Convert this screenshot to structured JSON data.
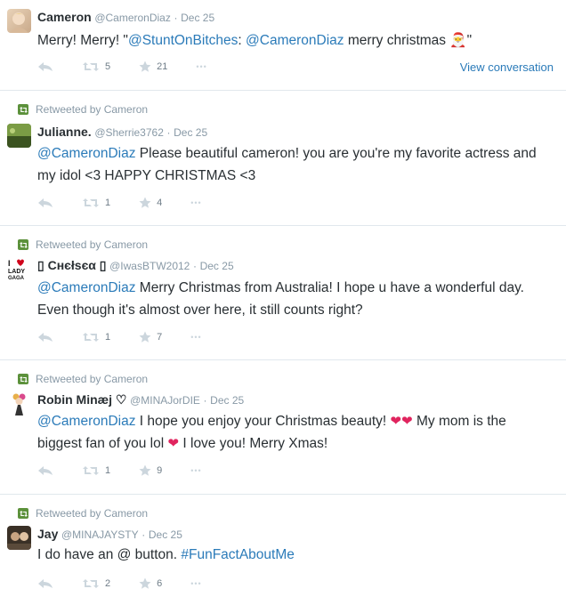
{
  "tweets": [
    {
      "retweeted_by": "",
      "name": "Cameron",
      "handle": "@CameronDiaz",
      "date": "Dec 25",
      "text_parts": {
        "a": "Merry! Merry! \"",
        "b": "@StuntOnBitches",
        "c": ": ",
        "d": "@CameronDiaz",
        "e": " merry christmas 🎅\""
      },
      "retweets": "5",
      "favorites": "21",
      "view_conversation": "View conversation"
    },
    {
      "retweeted_by": "Retweeted by Cameron",
      "name": "Julianne.",
      "handle": "@Sherrie3762",
      "date": "Dec 25",
      "text_parts": {
        "a": "@CameronDiaz",
        "b": " Please beautiful cameron! you are you're my favorite actress and my idol <3 HAPPY CHRISTMAS <3"
      },
      "retweets": "1",
      "favorites": "4"
    },
    {
      "retweeted_by": "Retweeted by Cameron",
      "name": "▯ Ϲнєłѕєα ▯",
      "handle": "@IwasBTW2012",
      "date": "Dec 25",
      "text_parts": {
        "a": "@CameronDiaz",
        "b": " Merry Christmas from Australia! I hope u have a wonderful day. Even though it's almost over here, it still counts right?"
      },
      "retweets": "1",
      "favorites": "7"
    },
    {
      "retweeted_by": "Retweeted by Cameron",
      "name": "Robin Minæj ♡",
      "handle": "@MINAJorDIE",
      "date": "Dec 25",
      "text_parts": {
        "a": "@CameronDiaz",
        "b": " I hope you enjoy your Christmas beauty! ",
        "c": "❤❤",
        "d": "  My mom is the biggest fan of you lol ",
        "e": "❤",
        "f": "  I love you! Merry Xmas!"
      },
      "retweets": "1",
      "favorites": "9"
    },
    {
      "retweeted_by": "Retweeted by Cameron",
      "name": "Jay",
      "handle": "@MINAJAYSTY",
      "date": "Dec 25",
      "text_parts": {
        "a": "I do have an @ button. ",
        "b": "#FunFactAboutMe"
      },
      "retweets": "2",
      "favorites": "6"
    }
  ],
  "ui": {
    "dot": "·",
    "more": "•••"
  },
  "colors": {
    "link": "#2b7bb9",
    "muted": "#8899a6",
    "retweet_green": "#5c913b",
    "heart": "#e0245e"
  }
}
